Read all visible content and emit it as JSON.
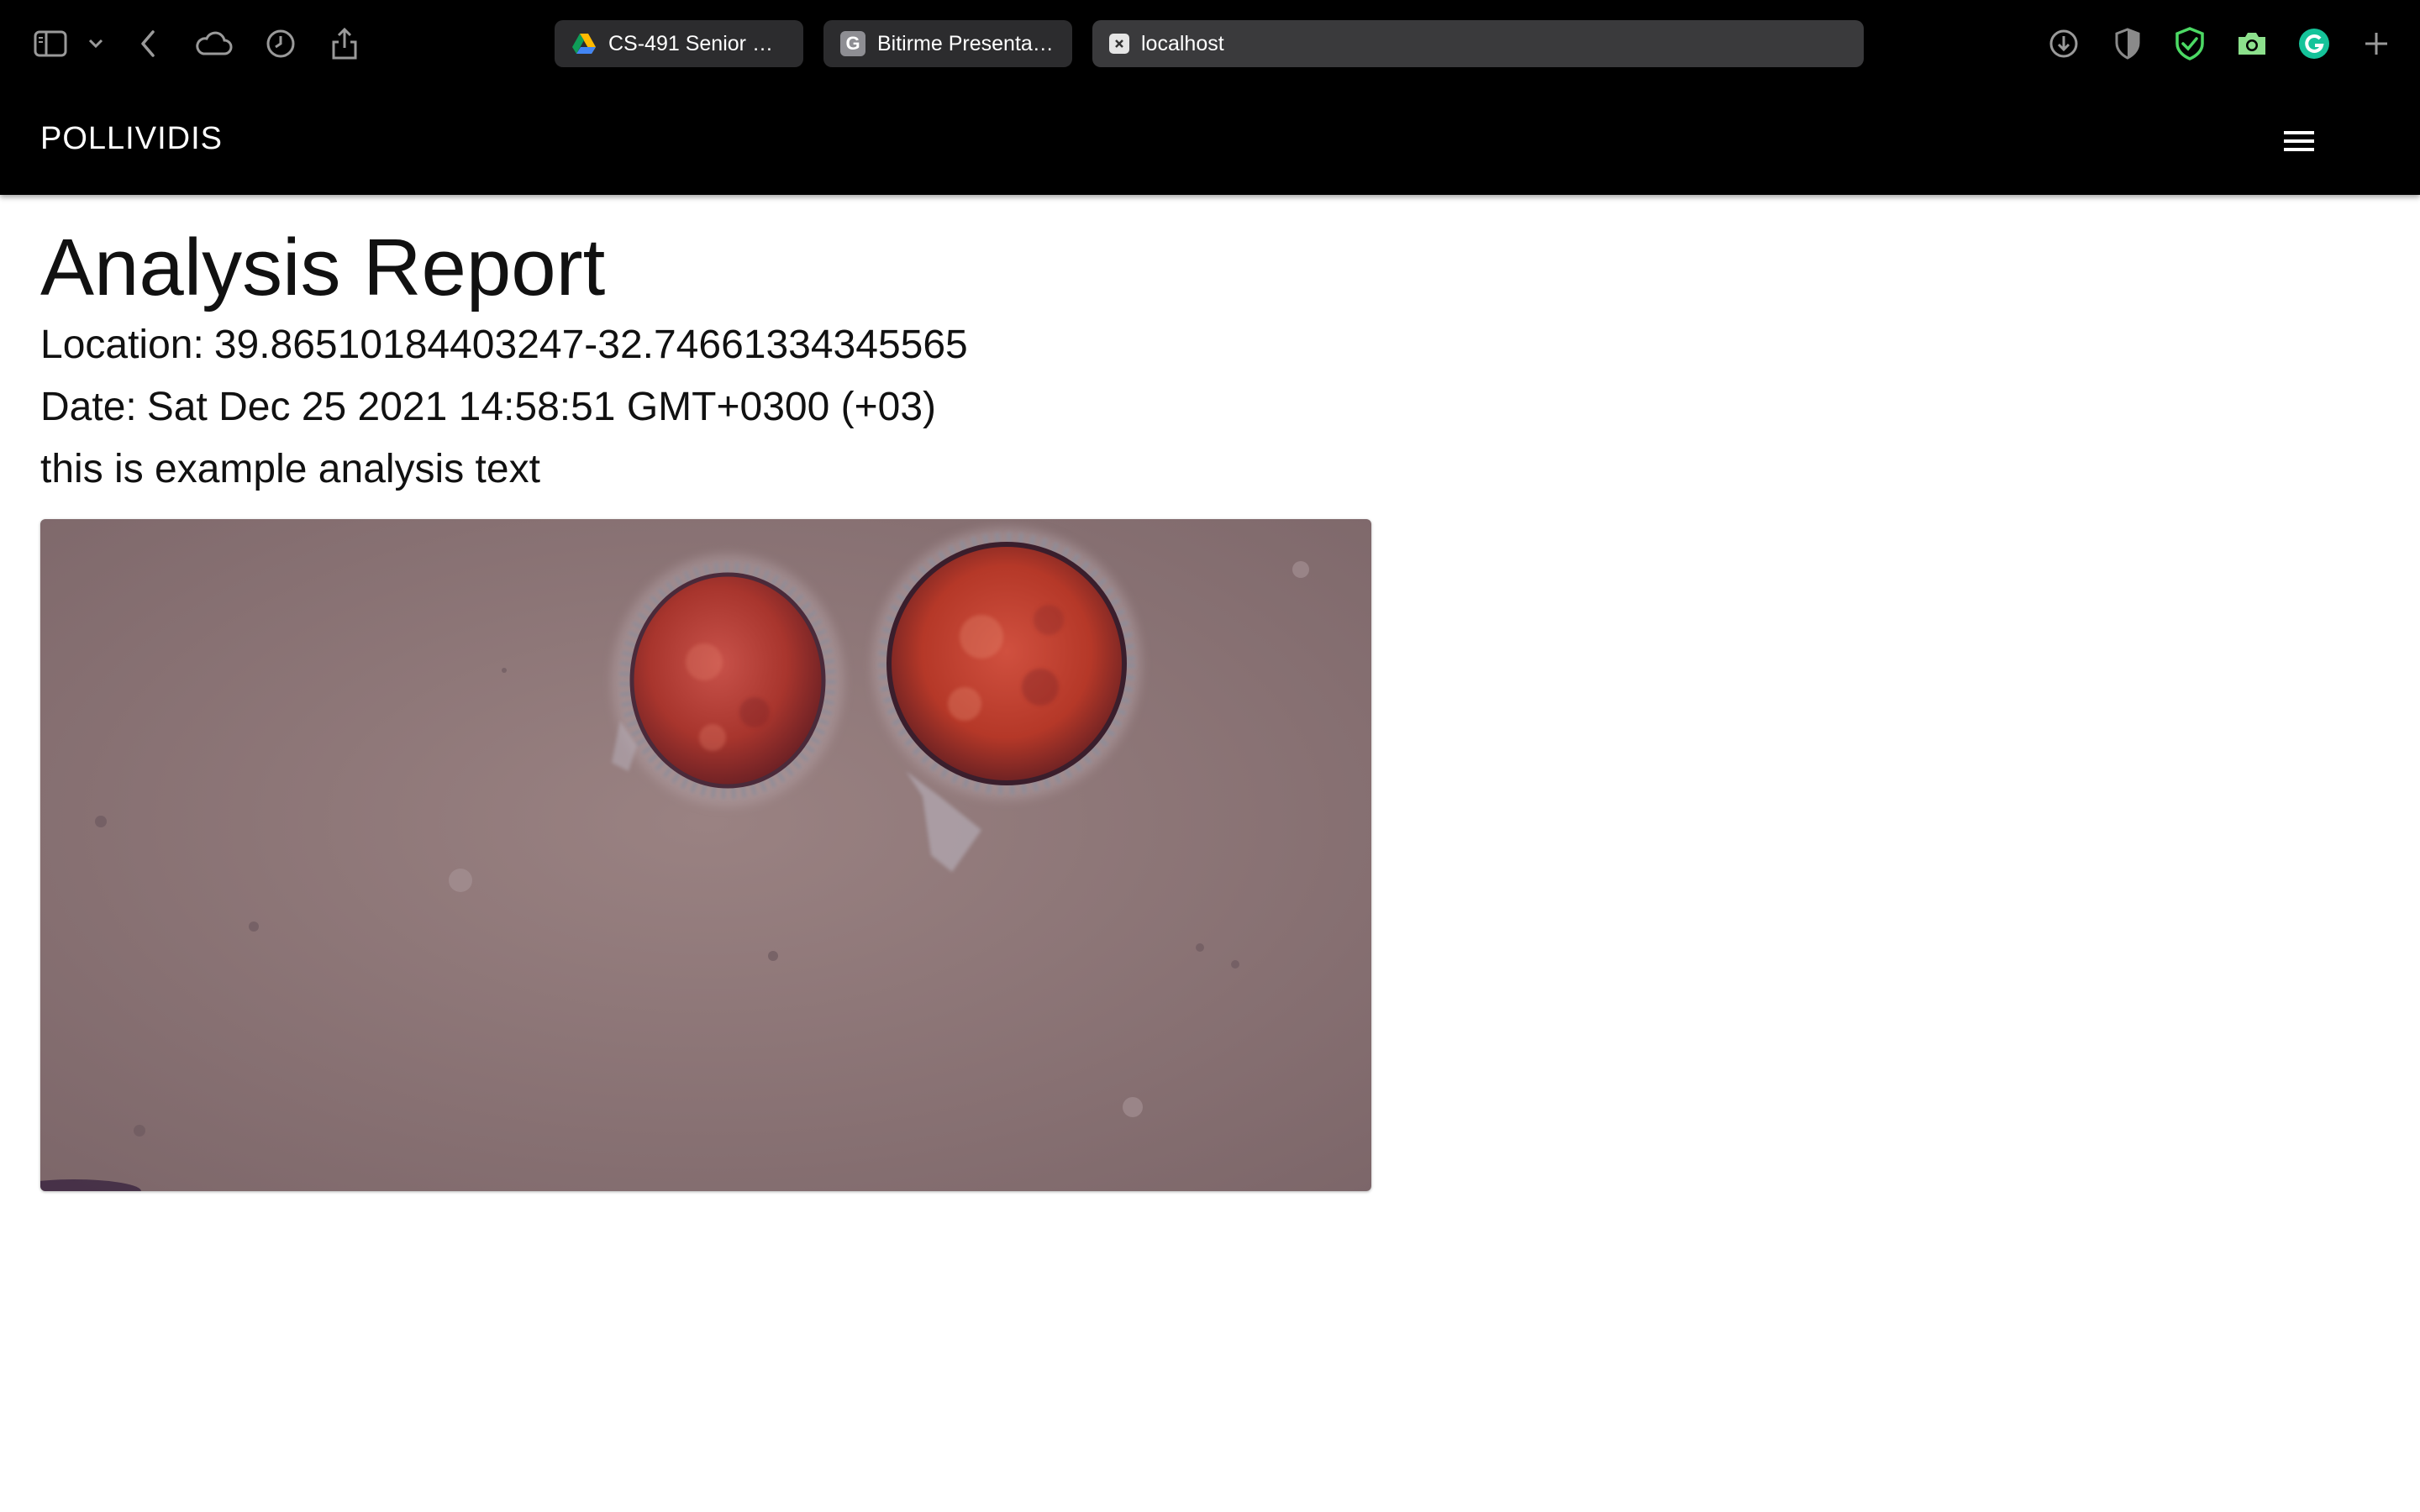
{
  "browser": {
    "tabs": [
      {
        "title": "CS-491 Senior Pr...",
        "icon": "google-drive-icon",
        "active": false
      },
      {
        "title": "Bitirme Presentat...",
        "icon": "google-g-icon",
        "icon_letter": "G",
        "active": false
      },
      {
        "title": "localhost",
        "icon": "page-error-icon",
        "active": true
      }
    ],
    "toolbar_icons": [
      "sidebar-toggle-icon",
      "chevron-down-icon",
      "back-arrow-icon",
      "cloud-icon",
      "history-clock-icon",
      "share-icon",
      "download-icon",
      "shield-half-icon",
      "adblock-shield-icon",
      "camera-icon",
      "grammarly-icon",
      "new-tab-plus-icon"
    ],
    "colors": {
      "shield_green": "#4cd964",
      "camera_green": "#8ce08c",
      "grammarly_green": "#15c39a"
    }
  },
  "nav": {
    "brand": "POLLIVIDIS",
    "menu_icon": "hamburger-menu-icon"
  },
  "report": {
    "title": "Analysis Report",
    "location_label": "Location:",
    "location_value": "39.86510184403247-32.74661334345565",
    "date_label": "Date:",
    "date_value": "Sat Dec 25 2021 14:58:51 GMT+0300 (+03)",
    "analysis_text": "this is example analysis text",
    "image_subject": "microscope-pollen-grains-image"
  }
}
